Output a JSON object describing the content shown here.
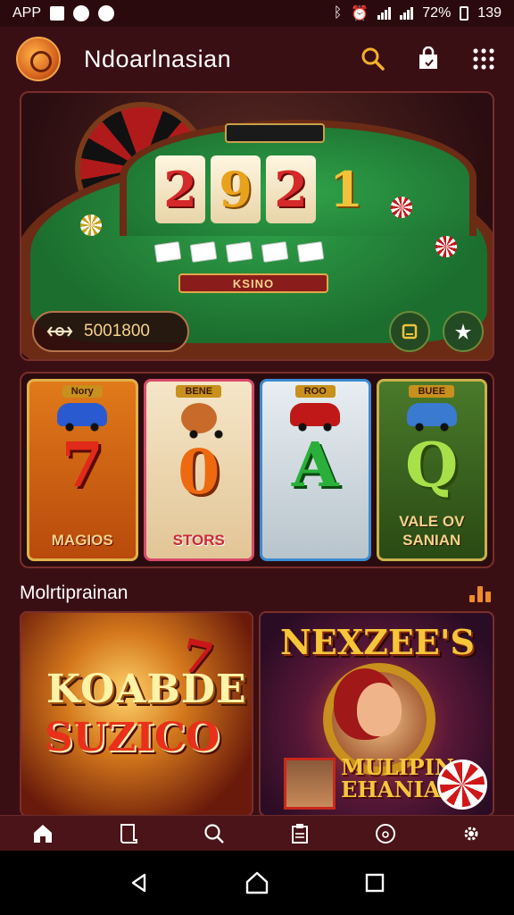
{
  "status_bar": {
    "left_label": "APP",
    "battery": "72%",
    "time": "139"
  },
  "header": {
    "title": "Ndoarlnasian",
    "icons": [
      "search-icon",
      "bag-icon",
      "grid-menu-icon"
    ]
  },
  "hero": {
    "reels": [
      "2",
      "9",
      "2",
      "1"
    ],
    "table_plate": "KSINO",
    "bet_amount": "5001800",
    "buttons": [
      "wallet-icon",
      "star-icon"
    ]
  },
  "slot_cards": [
    {
      "tag": "Nory",
      "symbol": "7",
      "label": "MAGIOS"
    },
    {
      "tag": "BENE",
      "symbol": "0",
      "label": "STORS"
    },
    {
      "tag": "ROO",
      "symbol": "A",
      "label": ""
    },
    {
      "tag": "BUEE",
      "symbol": "Q",
      "label": "VALE OV SANIAN"
    }
  ],
  "section": {
    "title": "Molrtiprainan"
  },
  "promos": {
    "left": {
      "line1": "KOABDE",
      "line2": "SUZICO"
    },
    "right": {
      "title": "NEXZEE'S",
      "subtitle_1": "MULIPIN",
      "subtitle_2": "EHANIAS"
    }
  },
  "tabs": [
    "home-icon",
    "book-icon",
    "search-icon",
    "clipboard-icon",
    "support-icon",
    "settings-icon"
  ],
  "colors": {
    "background": "#3a0f14",
    "accent": "#f6c63a",
    "felt": "#2fa24a"
  }
}
